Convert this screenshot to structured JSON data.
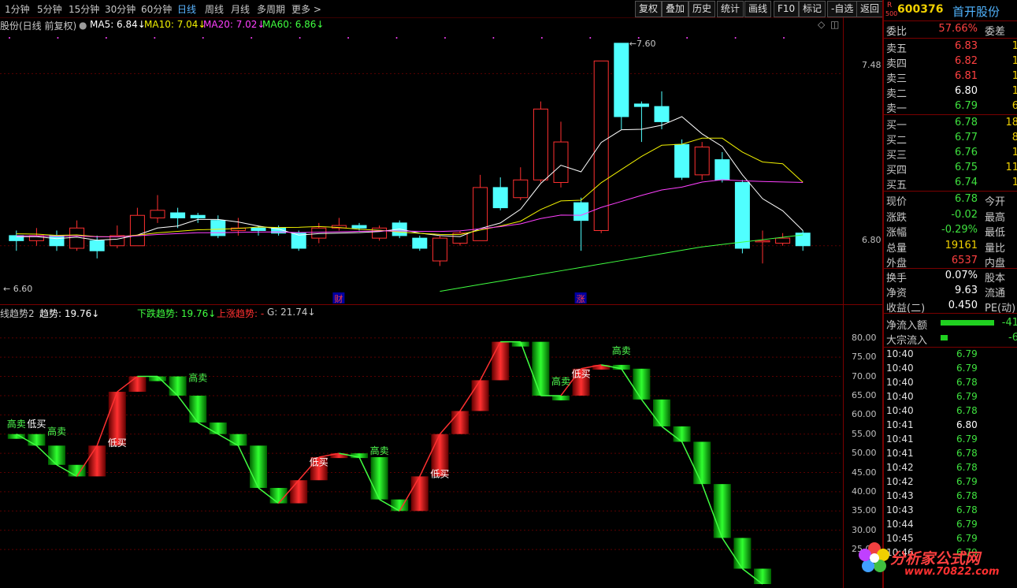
{
  "toolbar": {
    "periods": [
      "1分钟",
      "5分钟",
      "15分钟",
      "30分钟",
      "60分钟",
      "日线",
      "周线",
      "月线",
      "多周期",
      "更多 >"
    ],
    "active_period": "日线",
    "buttons": [
      "复权",
      "叠加",
      "历史",
      "统计",
      "画线",
      "F10",
      "标记",
      "-自选",
      "返回"
    ]
  },
  "stock": {
    "badge_top": "R",
    "badge_bottom": "500",
    "code": "600376",
    "name": "首开股份"
  },
  "main_chart": {
    "title": "股份(日线 前复权)",
    "ma5": "MA5: 6.84↓",
    "ma10": "MA10: 7.04↓",
    "ma20": "MA20: 7.02↓",
    "ma60": "MA60: 6.86↓",
    "high_label": "7.60",
    "low_label": "6.60",
    "y_ticks": [
      "7.48",
      "6.80"
    ],
    "markers": [
      "财",
      "涨"
    ],
    "colors": {
      "up": "#ff3030",
      "down": "#50ffff",
      "ma5": "#ffffff",
      "ma10": "#f0f000",
      "ma20": "#ff40ff",
      "ma60": "#40ff40"
    }
  },
  "indicator": {
    "title": "线趋势2",
    "trend": "趋势: 19.76↓",
    "down_trend": "下跌趋势: 19.76↓",
    "up_trend": "上涨趋势: -",
    "g": "G: 21.74↓",
    "y_ticks": [
      "80.00",
      "75.00",
      "70.00",
      "65.00",
      "60.00",
      "55.00",
      "50.00",
      "45.00",
      "40.00",
      "35.00",
      "30.00",
      "25.00"
    ],
    "sell_label": "高卖",
    "buy_label": "低买",
    "values": [
      55,
      52,
      47,
      44,
      52,
      66,
      70,
      70,
      65,
      58,
      55,
      52,
      41,
      37,
      43,
      49,
      50,
      49,
      38,
      35,
      44,
      55,
      61,
      69,
      79,
      79,
      65,
      65,
      72,
      73,
      72,
      64,
      57,
      53,
      42,
      28,
      20,
      16
    ]
  },
  "quote": {
    "wei_bi_label": "委比",
    "wei_bi": "57.66%",
    "wei_cha_label": "委差",
    "asks": [
      {
        "label": "卖五",
        "price": "6.83",
        "color": "red",
        "vol": "1"
      },
      {
        "label": "卖四",
        "price": "6.82",
        "color": "red",
        "vol": "1"
      },
      {
        "label": "卖三",
        "price": "6.81",
        "color": "red",
        "vol": "1"
      },
      {
        "label": "卖二",
        "price": "6.80",
        "color": "white",
        "vol": "1"
      },
      {
        "label": "卖一",
        "price": "6.79",
        "color": "green",
        "vol": "6"
      }
    ],
    "bids": [
      {
        "label": "买一",
        "price": "6.78",
        "color": "green",
        "vol": "18"
      },
      {
        "label": "买二",
        "price": "6.77",
        "color": "green",
        "vol": "8"
      },
      {
        "label": "买三",
        "price": "6.76",
        "color": "green",
        "vol": "1"
      },
      {
        "label": "买四",
        "price": "6.75",
        "color": "green",
        "vol": "11"
      },
      {
        "label": "买五",
        "price": "6.74",
        "color": "green",
        "vol": "1"
      }
    ],
    "stats": [
      {
        "label": "现价",
        "value": "6.78",
        "color": "green",
        "extra": "今开"
      },
      {
        "label": "涨跌",
        "value": "-0.02",
        "color": "green",
        "extra": "最高"
      },
      {
        "label": "涨幅",
        "value": "-0.29%",
        "color": "green",
        "extra": "最低"
      },
      {
        "label": "总量",
        "value": "19161",
        "color": "yellow",
        "extra": "量比"
      },
      {
        "label": "外盘",
        "value": "6537",
        "color": "red",
        "extra": "内盘"
      }
    ],
    "stats2": [
      {
        "label": "换手",
        "value": "0.07%",
        "color": "white",
        "extra": "股本"
      },
      {
        "label": "净资",
        "value": "9.63",
        "color": "white",
        "extra": "流通"
      },
      {
        "label": "收益(二)",
        "value": "0.450",
        "color": "white",
        "extra": "PE(动)"
      }
    ],
    "flows": [
      {
        "label": "净流入额",
        "value": "-41",
        "bar": 0.75
      },
      {
        "label": "大宗流入",
        "value": "-6",
        "bar": 0.1
      }
    ]
  },
  "trades": [
    {
      "time": "10:40",
      "price": "6.79",
      "color": "green"
    },
    {
      "time": "10:40",
      "price": "6.79",
      "color": "green"
    },
    {
      "time": "10:40",
      "price": "6.78",
      "color": "green"
    },
    {
      "time": "10:40",
      "price": "6.79",
      "color": "green"
    },
    {
      "time": "10:40",
      "price": "6.78",
      "color": "green"
    },
    {
      "time": "10:41",
      "price": "6.80",
      "color": "white"
    },
    {
      "time": "10:41",
      "price": "6.79",
      "color": "green"
    },
    {
      "time": "10:41",
      "price": "6.78",
      "color": "green"
    },
    {
      "time": "10:42",
      "price": "6.78",
      "color": "green"
    },
    {
      "time": "10:42",
      "price": "6.79",
      "color": "green"
    },
    {
      "time": "10:43",
      "price": "6.78",
      "color": "green"
    },
    {
      "time": "10:43",
      "price": "6.78",
      "color": "green"
    },
    {
      "time": "10:44",
      "price": "6.79",
      "color": "green"
    },
    {
      "time": "10:45",
      "price": "6.79",
      "color": "green"
    },
    {
      "time": "10:46",
      "price": "6.79",
      "color": "green"
    }
  ],
  "watermark": {
    "text": "分析家公式网",
    "url": "www.70822.com"
  },
  "chart_data": {
    "type": "candlestick",
    "candles": [
      {
        "o": 6.84,
        "c": 6.82,
        "h": 6.86,
        "l": 6.78
      },
      {
        "o": 6.82,
        "c": 6.84,
        "h": 6.87,
        "l": 6.8
      },
      {
        "o": 6.84,
        "c": 6.8,
        "h": 6.86,
        "l": 6.78
      },
      {
        "o": 6.79,
        "c": 6.87,
        "h": 6.9,
        "l": 6.78
      },
      {
        "o": 6.82,
        "c": 6.78,
        "h": 6.84,
        "l": 6.75
      },
      {
        "o": 6.8,
        "c": 6.84,
        "h": 6.88,
        "l": 6.79
      },
      {
        "o": 6.8,
        "c": 6.92,
        "h": 6.95,
        "l": 6.8
      },
      {
        "o": 6.91,
        "c": 6.94,
        "h": 7.0,
        "l": 6.89
      },
      {
        "o": 6.93,
        "c": 6.91,
        "h": 6.95,
        "l": 6.87
      },
      {
        "o": 6.92,
        "c": 6.91,
        "h": 6.93,
        "l": 6.89
      },
      {
        "o": 6.9,
        "c": 6.84,
        "h": 6.92,
        "l": 6.83
      },
      {
        "o": 6.86,
        "c": 6.87,
        "h": 6.91,
        "l": 6.84
      },
      {
        "o": 6.87,
        "c": 6.86,
        "h": 6.88,
        "l": 6.84
      },
      {
        "o": 6.87,
        "c": 6.85,
        "h": 6.88,
        "l": 6.84
      },
      {
        "o": 6.85,
        "c": 6.79,
        "h": 6.86,
        "l": 6.78
      },
      {
        "o": 6.83,
        "c": 6.87,
        "h": 6.89,
        "l": 6.81
      },
      {
        "o": 6.87,
        "c": 6.88,
        "h": 6.91,
        "l": 6.86
      },
      {
        "o": 6.88,
        "c": 6.87,
        "h": 6.89,
        "l": 6.86
      },
      {
        "o": 6.83,
        "c": 6.87,
        "h": 6.88,
        "l": 6.82
      },
      {
        "o": 6.89,
        "c": 6.84,
        "h": 6.9,
        "l": 6.83
      },
      {
        "o": 6.83,
        "c": 6.79,
        "h": 6.84,
        "l": 6.78
      },
      {
        "o": 6.74,
        "c": 6.83,
        "h": 6.84,
        "l": 6.72
      },
      {
        "o": 6.81,
        "c": 6.85,
        "h": 6.86,
        "l": 6.8
      },
      {
        "o": 6.82,
        "c": 7.03,
        "h": 7.08,
        "l": 6.82
      },
      {
        "o": 7.03,
        "c": 6.95,
        "h": 7.07,
        "l": 6.94
      },
      {
        "o": 6.99,
        "c": 7.06,
        "h": 7.11,
        "l": 6.98
      },
      {
        "o": 7.06,
        "c": 7.34,
        "h": 7.37,
        "l": 7.05
      },
      {
        "o": 7.05,
        "c": 7.21,
        "h": 7.29,
        "l": 7.03
      },
      {
        "o": 6.97,
        "c": 6.9,
        "h": 6.99,
        "l": 6.78
      },
      {
        "o": 6.86,
        "c": 7.53,
        "h": 7.53,
        "l": 6.85
      },
      {
        "o": 7.6,
        "c": 7.31,
        "h": 7.6,
        "l": 7.26
      },
      {
        "o": 7.36,
        "c": 7.35,
        "h": 7.37,
        "l": 7.21
      },
      {
        "o": 7.35,
        "c": 7.29,
        "h": 7.41,
        "l": 7.26
      },
      {
        "o": 7.2,
        "c": 7.07,
        "h": 7.22,
        "l": 7.06
      },
      {
        "o": 7.08,
        "c": 7.19,
        "h": 7.21,
        "l": 7.06
      },
      {
        "o": 7.14,
        "c": 7.06,
        "h": 7.17,
        "l": 7.05
      },
      {
        "o": 7.05,
        "c": 6.79,
        "h": 7.06,
        "l": 6.77
      },
      {
        "o": 6.82,
        "c": 6.82,
        "h": 6.86,
        "l": 6.73
      },
      {
        "o": 6.81,
        "c": 6.83,
        "h": 6.85,
        "l": 6.8
      },
      {
        "o": 6.85,
        "c": 6.8,
        "h": 6.86,
        "l": 6.78
      }
    ],
    "ylim": [
      6.6,
      7.64
    ]
  }
}
